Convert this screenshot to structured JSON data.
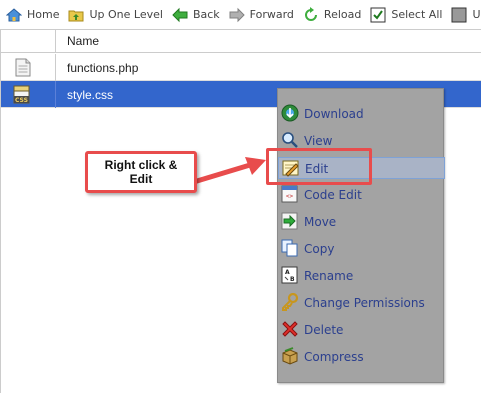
{
  "toolbar": {
    "home": "Home",
    "up_one_level": "Up One Level",
    "back": "Back",
    "forward": "Forward",
    "reload": "Reload",
    "select_all": "Select All",
    "unselect_all": "Unselect A"
  },
  "table": {
    "header_name": "Name",
    "rows": [
      {
        "name": "functions.php",
        "selected": false
      },
      {
        "name": "style.css",
        "selected": true
      }
    ]
  },
  "context_menu": {
    "items": [
      {
        "label": "Download",
        "icon": "download-icon"
      },
      {
        "label": "View",
        "icon": "magnifier-icon"
      },
      {
        "label": "Edit",
        "icon": "pencil-icon"
      },
      {
        "label": "Code Edit",
        "icon": "code-edit-icon"
      },
      {
        "label": "Move",
        "icon": "move-arrow-icon"
      },
      {
        "label": "Copy",
        "icon": "copy-icon"
      },
      {
        "label": "Rename",
        "icon": "rename-icon"
      },
      {
        "label": "Change Permissions",
        "icon": "key-icon"
      },
      {
        "label": "Delete",
        "icon": "delete-x-icon"
      },
      {
        "label": "Compress",
        "icon": "archive-box-icon"
      }
    ],
    "hovered_item": "Edit"
  },
  "annotation": {
    "line1": "Right click &",
    "line2": "Edit"
  },
  "colors": {
    "selected_row": "#3366cc",
    "menu_bg": "#a3a3a3",
    "menu_text": "#2b3f8e",
    "annotation_red": "#e84c4c"
  }
}
